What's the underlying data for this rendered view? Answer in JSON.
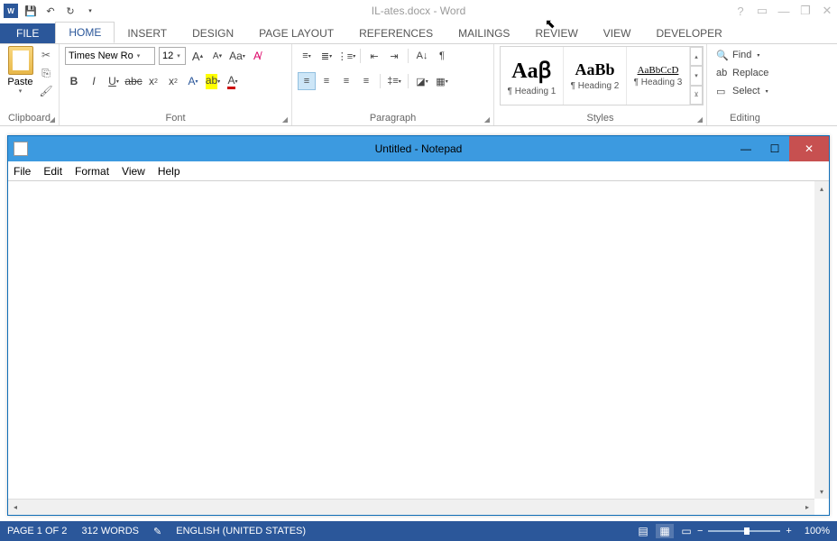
{
  "word": {
    "title": "IL-ates.docx - Word",
    "tabs": [
      "FILE",
      "HOME",
      "INSERT",
      "DESIGN",
      "PAGE LAYOUT",
      "REFERENCES",
      "MAILINGS",
      "REVIEW",
      "VIEW",
      "DEVELOPER"
    ],
    "groups": {
      "clipboard": "Clipboard",
      "font": "Font",
      "paragraph": "Paragraph",
      "styles": "Styles",
      "editing": "Editing"
    },
    "clipboard": {
      "paste": "Paste"
    },
    "font": {
      "name": "Times New Ro",
      "size": "12"
    },
    "styles": [
      {
        "preview": "Aaꞵ",
        "name": "¶ Heading 1",
        "size": "24px",
        "weight": "bold"
      },
      {
        "preview": "AaBb",
        "name": "¶ Heading 2",
        "size": "18px",
        "weight": "bold"
      },
      {
        "preview": "AaBbCcD",
        "name": "¶ Heading 3",
        "size": "11px",
        "weight": "normal",
        "underline": true
      }
    ],
    "editing": {
      "find": "Find",
      "replace": "Replace",
      "select": "Select"
    }
  },
  "notepad": {
    "title": "Untitled - Notepad",
    "menus": [
      "File",
      "Edit",
      "Format",
      "View",
      "Help"
    ]
  },
  "status": {
    "page": "PAGE 1 OF 2",
    "words": "312 WORDS",
    "lang": "ENGLISH (UNITED STATES)",
    "zoom": "100%"
  }
}
